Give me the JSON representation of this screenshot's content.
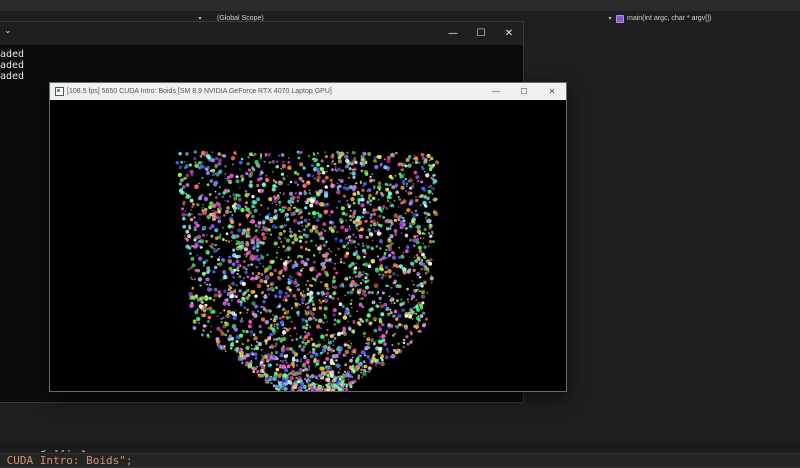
{
  "ide": {
    "navbar": {
      "scope_label": "(Global Scope)",
      "dropdown_glyph": "▾",
      "function_label": "main(int argc, char * argv[])"
    },
    "code": {
      "line1_kw": "ar",
      "line1_rest": "* argv[]) {",
      "line2_prefix": " CUDA Intro: Boids",
      "line2_suffix": "\";"
    }
  },
  "console": {
    "chevron": "⌄",
    "lines": [
      "aded",
      "aded",
      "aded"
    ],
    "buttons": {
      "minimize": "—",
      "maximize": "☐",
      "close": "✕"
    }
  },
  "boids_window": {
    "title": "[108.5 fps] 5650 CUDA Intro: Boids [SM 8.9 NVIDIA GeForce RTX 4070 Laptop GPU]",
    "buttons": {
      "minimize": "—",
      "maximize": "☐",
      "close": "✕"
    },
    "particle_colors": [
      "#ff4fd8",
      "#4a6bff",
      "#5ef0ff",
      "#8aff5a",
      "#ffdf4a",
      "#b36bff",
      "#ff6a6a",
      "#6affc9",
      "#ffffff",
      "#ff9a3c",
      "#3cff7a",
      "#c0a0ff"
    ]
  }
}
